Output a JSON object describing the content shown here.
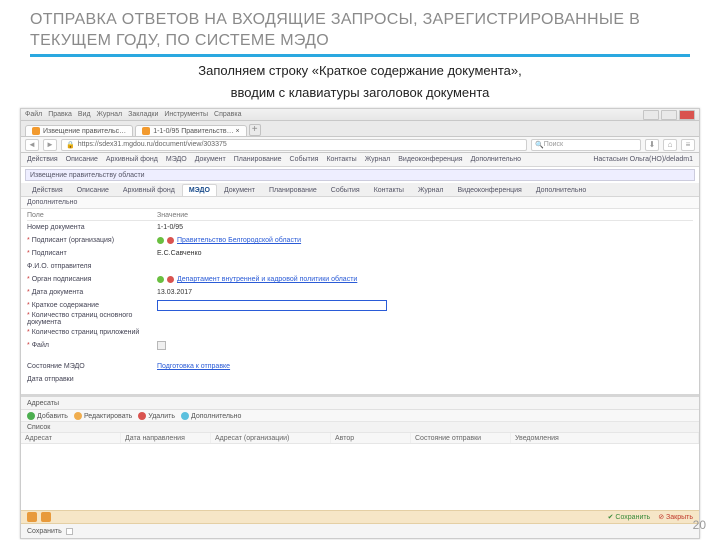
{
  "slide": {
    "title": "ОТПРАВКА ОТВЕТОВ НА ВХОДЯЩИЕ ЗАПРОСЫ, ЗАРЕГИСТРИРОВАННЫЕ  В  ТЕКУЩЕМ  ГОДУ, ПО СИСТЕМЕ МЭДО",
    "caption1": "Заполняем строку «Краткое содержание документа»,",
    "caption2": "вводим с клавиатуры заголовок документа",
    "page": "20"
  },
  "ff": {
    "menu": {
      "file": "Файл",
      "edit": "Правка",
      "view": "Вид",
      "log": "Журнал",
      "bm": "Закладки",
      "tools": "Инструменты",
      "help": "Справка"
    },
    "tab1": "Извещение правительс…",
    "tab2": "1-1-0/95 Правительств… ×",
    "url": "https://sdex31.mgdou.ru/document/view/303375",
    "search": "Поиск"
  },
  "app": {
    "topbar": {
      "actions": "Действия",
      "desc": "Описание",
      "arch": "Архивный фонд",
      "medo": "МЭДО",
      "doc": "Документ",
      "plan": "Планирование",
      "events": "События",
      "contacts": "Контакты",
      "log": "Журнал",
      "video": "Видеоконференция",
      "extra": "Дополнительно",
      "user": "Настасьин Ольга(НО)/deladm1"
    },
    "dochdr": "Извещение правительству области",
    "tabs": {
      "actions": "Действия",
      "desc": "Описание",
      "arch": "Архивный фонд",
      "medo": "МЭДО",
      "doc": "Документ",
      "plan": "Планирование",
      "events": "События",
      "contacts": "Контакты",
      "log": "Журнал",
      "video": "Видеоконференция",
      "extra": "Дополнительно"
    },
    "section": "Дополнительно",
    "formhead": {
      "field": "Поле",
      "value": "Значение"
    }
  },
  "fields": {
    "num": {
      "label": "Номер документа",
      "value": "1-1-0/95"
    },
    "signorg": {
      "label": "Подписант (организация)",
      "value": "Правительство Белгородской области"
    },
    "signer": {
      "label": "Подписант",
      "value": "Е.С.Савченко"
    },
    "sender": {
      "label": "Ф.И.О. отправителя"
    },
    "senddept": {
      "label": "Орган подписания",
      "value": "Департамент внутренней и кадровой политики области"
    },
    "date": {
      "label": "Дата документа",
      "value": "13.03.2017"
    },
    "summary": {
      "label": "Краткое содержание"
    },
    "pages": {
      "label": "Количество страниц основного документа"
    },
    "attach": {
      "label": "Количество страниц приложений"
    },
    "file": {
      "label": "Файл"
    },
    "status": {
      "label": "Состояние МЭДО",
      "value": "Подготовка к отправке"
    },
    "sentdate": {
      "label": "Дата отправки"
    }
  },
  "panel2": {
    "head": "Адресаты",
    "tb": {
      "add": "Добавить",
      "edit": "Редактировать",
      "del": "Удалить",
      "more": "Дополнительно"
    },
    "subtab": "Список",
    "cols": {
      "addr": "Адресат",
      "date": "Дата направления",
      "org": "Адресат (организации)",
      "author": "Автор",
      "state": "Состояние отправки",
      "note": "Уведомления"
    }
  },
  "footer": {
    "save": "Сохранить",
    "close": "Закрыть",
    "save2": "Сохранить"
  }
}
